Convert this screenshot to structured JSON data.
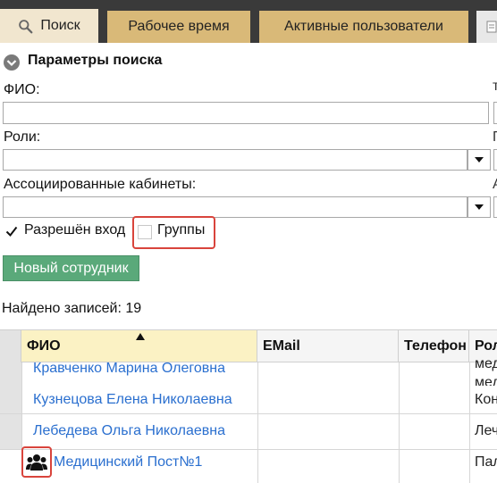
{
  "tabs": [
    {
      "label": "Поиск",
      "icon": "search-icon",
      "active": true
    },
    {
      "label": "Рабочее время",
      "active": false
    },
    {
      "label": "Активные пользователи",
      "active": false
    }
  ],
  "search_panel": {
    "title": "Параметры поиска",
    "fio_label": "ФИО:",
    "fio_value": "",
    "roles_label": "Роли:",
    "roles_value": "",
    "cabinets_label": "Ассоциированные кабинеты:",
    "cabinets_value": "",
    "login_allowed_label": "Разрешён вход",
    "login_allowed_checked": true,
    "groups_label": "Группы",
    "groups_checked": false,
    "right_edge_chars": [
      "т",
      "Г",
      "А"
    ]
  },
  "new_employee_button": "Новый сотрудник",
  "found_records": "Найдено записей: 19",
  "table": {
    "columns": [
      "ФИО",
      "EMail",
      "Телефон",
      "Рол"
    ],
    "rows": [
      {
        "name": "Кравченко Марина Олеговна",
        "email": "",
        "phone": "",
        "role_lines": [
          "мед",
          "мед"
        ]
      },
      {
        "name": "Кузнецова Елена Николаевна",
        "email": "",
        "phone": "",
        "role_lines": [
          "Кон"
        ]
      },
      {
        "name": "Лебедева Ольга Николаевна",
        "email": "",
        "phone": "",
        "role_lines": [
          "Леч"
        ]
      },
      {
        "name": "Медицинский Пост№1",
        "email": "",
        "phone": "",
        "role_lines": [
          "Пал"
        ],
        "is_group": true,
        "icon": "group-users-icon"
      }
    ]
  },
  "colors": {
    "tab_bar_bg": "#3a3a3a",
    "tab_bg": "#d9b978",
    "tab_active_bg": "#f1e6cf",
    "button_green": "#5aa97a",
    "link_blue": "#2a6fcf",
    "highlight_red": "#d9443c",
    "header_yellow": "#fbf2c4"
  }
}
